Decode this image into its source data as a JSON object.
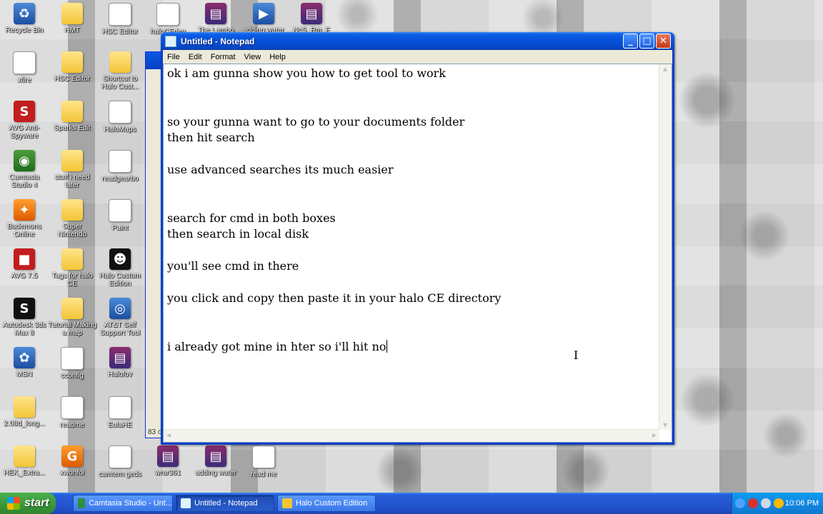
{
  "desktop": {
    "icons": [
      {
        "label": "Recycle Bin",
        "glyph": "♻",
        "kind": "g-blue"
      },
      {
        "label": "HMT",
        "glyph": "",
        "kind": "g-folder"
      },
      {
        "label": "HSC Editor",
        "glyph": "≡",
        "kind": "g-doc"
      },
      {
        "label": "haloCEdev",
        "glyph": "◻",
        "kind": "g-doc"
      },
      {
        "label": "The Lambo",
        "glyph": "▤",
        "kind": "g-rar"
      },
      {
        "label": "adding water",
        "glyph": "▶",
        "kind": "g-blue"
      },
      {
        "label": "NcS_Rm_F",
        "glyph": "▤",
        "kind": "g-rar"
      },
      {
        "label": "xfire",
        "glyph": "✕",
        "kind": "g-doc"
      },
      {
        "label": "HSC Editor",
        "glyph": "",
        "kind": "g-folder"
      },
      {
        "label": "Shortcut to Halo Cust...",
        "glyph": "",
        "kind": "g-folder"
      },
      {
        "label": "AVG Anti-Spyware",
        "glyph": "S",
        "kind": "g-red"
      },
      {
        "label": "Sparks Edit",
        "glyph": "",
        "kind": "g-folder"
      },
      {
        "label": "HaloMaps",
        "glyph": "≡",
        "kind": "g-doc"
      },
      {
        "label": "Camtasia Studio 4",
        "glyph": "◉",
        "kind": "g-app"
      },
      {
        "label": "stuff i need later",
        "glyph": "",
        "kind": "g-folder"
      },
      {
        "label": "readgearbo",
        "glyph": "≡",
        "kind": "g-doc"
      },
      {
        "label": "Budemons Online",
        "glyph": "✦",
        "kind": "g-orange"
      },
      {
        "label": "Super Nintendo",
        "glyph": "",
        "kind": "g-folder"
      },
      {
        "label": "Paint",
        "glyph": "✎",
        "kind": "g-doc"
      },
      {
        "label": "AVG 7.5",
        "glyph": "■",
        "kind": "g-red"
      },
      {
        "label": "Tags for halo CE",
        "glyph": "",
        "kind": "g-folder"
      },
      {
        "label": "Halo Custom Edition",
        "glyph": "☻",
        "kind": "g-dark"
      },
      {
        "label": "Autodesk 3ds Max 8",
        "glyph": "S",
        "kind": "g-dark"
      },
      {
        "label": "Tutorial Making a map",
        "glyph": "",
        "kind": "g-folder"
      },
      {
        "label": "AT&T Self Support Tool",
        "glyph": "◎",
        "kind": "g-blue"
      },
      {
        "label": "MSN",
        "glyph": "✿",
        "kind": "g-blue"
      },
      {
        "label": "cconfig",
        "glyph": "⚙",
        "kind": "g-doc"
      },
      {
        "label": "Halofov",
        "glyph": "▤",
        "kind": "g-rar"
      },
      {
        "label": "2.08d_long...",
        "glyph": "",
        "kind": "g-folder"
      },
      {
        "label": "readme",
        "glyph": "≡",
        "kind": "g-doc"
      },
      {
        "label": "EulaHE",
        "glyph": "✎",
        "kind": "g-doc"
      },
      {
        "label": "HEK_Extra...",
        "glyph": "",
        "kind": "g-folder"
      },
      {
        "label": "xwonfoi",
        "glyph": "G",
        "kind": "g-orange"
      },
      {
        "label": "camtem geds",
        "glyph": "≡",
        "kind": "g-doc"
      },
      {
        "label": "wrar361",
        "glyph": "▤",
        "kind": "g-rar"
      },
      {
        "label": "adding water",
        "glyph": "▤",
        "kind": "g-rar"
      },
      {
        "label": "read me",
        "glyph": "≡",
        "kind": "g-doc"
      }
    ]
  },
  "background_window": {
    "status": "83 o"
  },
  "notepad": {
    "title": "Untitled - Notepad",
    "menu": [
      "File",
      "Edit",
      "Format",
      "View",
      "Help"
    ],
    "lines": [
      "ok i am gunna show you how to get tool to work",
      "",
      "",
      "so your gunna want to go to your documents folder",
      "then hit search",
      "",
      "use advanced searches its much easier",
      "",
      "",
      "search for cmd in both boxes",
      "then search in local disk",
      "",
      "you'll see cmd in there",
      "",
      "you click and copy then paste it in your halo CE directory",
      "",
      "",
      "i already got mine in hter so i'll hit no"
    ]
  },
  "taskbar": {
    "start_label": "start",
    "tasks": [
      {
        "label": "Camtasia Studio - Unt...",
        "active": false,
        "color": "#2f8f3a"
      },
      {
        "label": "Untitled - Notepad",
        "active": true,
        "color": "#dff2ff"
      },
      {
        "label": "Halo Custom Edition",
        "active": false,
        "color": "#f3c536"
      }
    ],
    "clock": "10:06 PM"
  }
}
